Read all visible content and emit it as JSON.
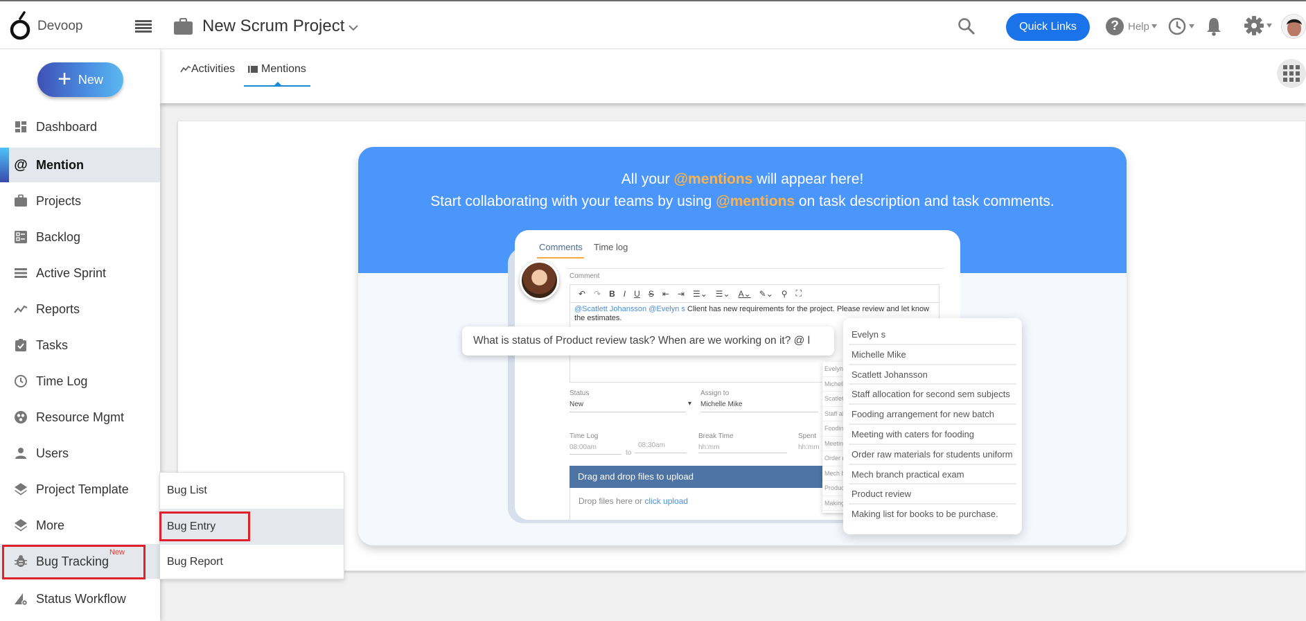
{
  "header": {
    "brand": "Devoop",
    "project_title": "New Scrum Project",
    "quick_links_label": "Quick Links",
    "help_label": "Help",
    "colors": {
      "primary": "#1a73e8",
      "icon_gray": "#777777"
    }
  },
  "sidebar": {
    "new_label": "New",
    "items": [
      {
        "label": "Dashboard",
        "icon": "dashboard-icon"
      },
      {
        "label": "Mention",
        "icon": "at-sign-icon",
        "active": true
      },
      {
        "label": "Projects",
        "icon": "briefcase-icon"
      },
      {
        "label": "Backlog",
        "icon": "backlog-icon"
      },
      {
        "label": "Active Sprint",
        "icon": "list-icon"
      },
      {
        "label": "Reports",
        "icon": "trend-line-icon"
      },
      {
        "label": "Tasks",
        "icon": "clipboard-check-icon"
      },
      {
        "label": "Time Log",
        "icon": "clock-icon"
      },
      {
        "label": "Resource Mgmt",
        "icon": "resource-icon"
      },
      {
        "label": "Users",
        "icon": "user-icon"
      },
      {
        "label": "Project Template",
        "icon": "layers-icon"
      },
      {
        "label": "More",
        "icon": "layers-icon"
      },
      {
        "label": "Bug Tracking",
        "icon": "bug-icon",
        "badge": "New",
        "highlighted": true
      },
      {
        "label": "Status Workflow",
        "icon": "workflow-icon"
      }
    ]
  },
  "submenu": {
    "items": [
      {
        "label": "Bug List"
      },
      {
        "label": "Bug Entry",
        "highlighted": true
      },
      {
        "label": "Bug Report"
      }
    ]
  },
  "tabs": [
    {
      "label": "Activities",
      "icon": "activity-icon"
    },
    {
      "label": "Mentions",
      "icon": "mentions-icon",
      "active": true
    }
  ],
  "banner": {
    "line1_pre": "All your ",
    "line1_hl": "@mentions",
    "line1_post": " will appear here!",
    "line2_pre": "Start collaborating with your teams by using ",
    "line2_hl": "@mentions",
    "line2_post": " on task description and task comments.",
    "colors": {
      "banner_blue": "#4b96fb",
      "highlight": "#ffb347"
    }
  },
  "mock": {
    "tab_comments": "Comments",
    "tab_timelog": "Time log",
    "comment_label": "Comment",
    "editor_mention1": "@Scatlett Johansson",
    "editor_mention2": "@Evelyn s",
    "editor_text": " Client has new requirements for the project. Please review and let know the estimates.",
    "status_label": "Status",
    "status_value": "New",
    "assign_label": "Assign to",
    "assign_value": "Michelle Mike",
    "timelog_label": "Time Log",
    "time_from": "08:00am",
    "time_to_word": "to",
    "time_to": "08:30am",
    "break_label": "Break Time",
    "break_placeholder": "hh:mm",
    "spent_label": "Spent",
    "spent_placeholder": "hh:mm",
    "dropzone_title": "Drag and drop files to upload",
    "dropzone_text": "Drop files here or ",
    "dropzone_link": "click upload",
    "bubble_text": "What is status of Product review task? When are we working on it? @ l",
    "mention_suggestions": [
      "Evelyn s",
      "Michelle Mike",
      "Scatlett Johansson",
      "Staff allocation for second sem subjects",
      "Fooding arrangement for new batch",
      "Meeting with caters for fooding",
      "Order raw materials for students uniform",
      "Mech branch practical exam",
      "Product review",
      "Making list for books to be purchase."
    ]
  }
}
